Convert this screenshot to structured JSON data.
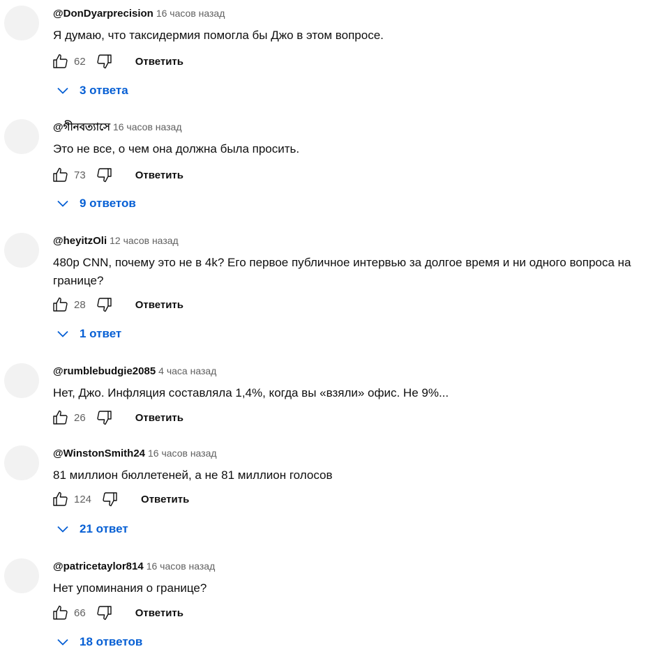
{
  "ui": {
    "reply_label": "Ответить"
  },
  "comments": [
    {
      "author": "@DonDyarprecision",
      "time": "16 часов назад",
      "text": "Я думаю, что таксидермия помогла бы Джо в этом вопросе.",
      "likes": "62",
      "replies": "3 ответа"
    },
    {
      "author": "@গীনবত্যাসে",
      "time": "16 часов назад",
      "text": "Это не все, о чем она должна была просить.",
      "likes": "73",
      "replies": "9 ответов"
    },
    {
      "author": "@heyitzOli",
      "time": "12 часов назад",
      "text": "480p CNN, почему это не в 4k? Его первое публичное интервью за долгое время и ни одного вопроса на границе?",
      "likes": "28",
      "replies": "1 ответ"
    },
    {
      "author": "@rumblebudgie2085",
      "time": "4 часа назад",
      "text": "Нет, Джо. Инфляция составляла 1,4%, когда вы «взяли» офис. Не 9%...",
      "likes": "26"
    },
    {
      "author": "@WinstonSmith24",
      "time": "16 часов назад",
      "text": "81 миллион бюллетеней, а не 81 миллион голосов",
      "likes": "124",
      "replies": "21 ответ"
    },
    {
      "author": "@patricetaylor814",
      "time": "16 часов назад",
      "text": "Нет упоминания о границе?",
      "likes": "66",
      "replies": "18 ответов"
    }
  ],
  "icons": {
    "like": "thumb-up-icon",
    "dislike": "thumb-down-icon",
    "expand": "chevron-down-icon"
  },
  "colors": {
    "link_blue": "#065fd4",
    "meta_gray": "#606060",
    "text": "#0f0f0f",
    "avatar_placeholder": "#f2f2f2"
  }
}
